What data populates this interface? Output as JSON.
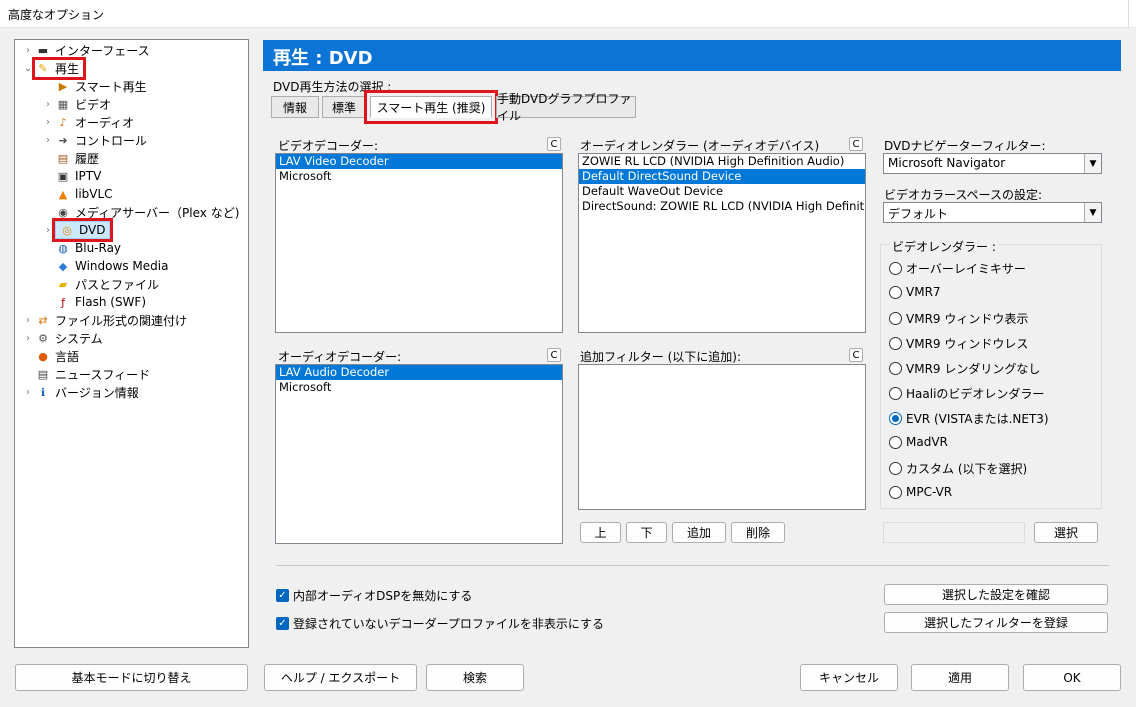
{
  "window": {
    "title": "高度なオプション"
  },
  "tree": [
    {
      "label": "インターフェース",
      "icon": "monitor-icon",
      "chev": "›",
      "indent": 0
    },
    {
      "label": "再生",
      "icon": "pencil-icon",
      "chev": "⌄",
      "indent": 0,
      "highlight": true
    },
    {
      "label": "スマート再生",
      "icon": "smart-play-icon",
      "chev": "",
      "indent": 1
    },
    {
      "label": "ビデオ",
      "icon": "film-icon",
      "chev": "›",
      "indent": 1
    },
    {
      "label": "オーディオ",
      "icon": "music-note-icon",
      "chev": "›",
      "indent": 1
    },
    {
      "label": "コントロール",
      "icon": "control-icon",
      "chev": "›",
      "indent": 1
    },
    {
      "label": "履歴",
      "icon": "history-icon",
      "chev": "",
      "indent": 1
    },
    {
      "label": "IPTV",
      "icon": "iptv-icon",
      "chev": "",
      "indent": 1
    },
    {
      "label": "libVLC",
      "icon": "vlc-cone-icon",
      "chev": "",
      "indent": 1
    },
    {
      "label": "メディアサーバー（Plex など)",
      "icon": "media-server-icon",
      "chev": "",
      "indent": 1
    },
    {
      "label": "DVD",
      "icon": "dvd-icon",
      "chev": "›",
      "indent": 1,
      "selected": true,
      "highlight": true
    },
    {
      "label": "Blu-Ray",
      "icon": "bluray-icon",
      "chev": "",
      "indent": 1
    },
    {
      "label": "Windows Media",
      "icon": "windows-media-icon",
      "chev": "",
      "indent": 1
    },
    {
      "label": "パスとファイル",
      "icon": "folder-icon",
      "chev": "",
      "indent": 1
    },
    {
      "label": "Flash (SWF)",
      "icon": "flash-icon",
      "chev": "",
      "indent": 1
    },
    {
      "label": "ファイル形式の関連付け",
      "icon": "file-assoc-icon",
      "chev": "›",
      "indent": 0
    },
    {
      "label": "システム",
      "icon": "gear-icon",
      "chev": "›",
      "indent": 0
    },
    {
      "label": "言語",
      "icon": "language-icon",
      "chev": "",
      "indent": 0
    },
    {
      "label": "ニュースフィード",
      "icon": "news-icon",
      "chev": "",
      "indent": 0
    },
    {
      "label": "バージョン情報",
      "icon": "info-icon",
      "chev": "›",
      "indent": 0
    }
  ],
  "header": {
    "title": "再生 : DVD"
  },
  "playback_method": {
    "label": "DVD再生方法の選択 :",
    "tabs": [
      "情報",
      "標準",
      "スマート再生 (推奨)",
      "手動DVDグラフプロファイル"
    ],
    "active_tab": 2
  },
  "video_decoder": {
    "label": "ビデオデコーダー:",
    "clear": "C",
    "items": [
      "LAV Video Decoder",
      "Microsoft"
    ],
    "selected": 0
  },
  "audio_renderer": {
    "label": "オーディオレンダラー (オーディオデバイス)",
    "clear": "C",
    "items": [
      "ZOWIE RL LCD (NVIDIA High Definition Audio)",
      "Default DirectSound Device",
      "Default WaveOut Device",
      "DirectSound: ZOWIE RL LCD (NVIDIA High Definition A"
    ],
    "selected": 1
  },
  "audio_decoder": {
    "label": "オーディオデコーダー:",
    "clear": "C",
    "items": [
      "LAV Audio Decoder",
      "Microsoft"
    ],
    "selected": 0
  },
  "additional_filters": {
    "label": "追加フィルター (以下に追加):",
    "clear": "C",
    "items": []
  },
  "filter_buttons": {
    "up": "上",
    "down": "下",
    "add": "追加",
    "delete": "削除"
  },
  "dvd_navigator": {
    "label": "DVDナビゲーターフィルター:",
    "value": "Microsoft Navigator"
  },
  "color_space": {
    "label": "ビデオカラースペースの設定:",
    "value": "デフォルト"
  },
  "video_renderer": {
    "label": "ビデオレンダラー :",
    "options": [
      "オーバーレイミキサー",
      "VMR7",
      "VMR9 ウィンドウ表示",
      "VMR9 ウィンドウレス",
      "VMR9 レンダリングなし",
      "Haaliのビデオレンダラー",
      "EVR (VISTAまたは.NET3)",
      "MadVR",
      "カスタム (以下を選択)",
      "MPC-VR"
    ],
    "selected": 6
  },
  "select_button": "選択",
  "checkboxes": {
    "disable_dsp": "内部オーディオDSPを無効にする",
    "hide_unregistered": "登録されていないデコーダープロファイルを非表示にする"
  },
  "confirm_button": "選択した設定を確認",
  "register_button": "選択したフィルターを登録",
  "footer": {
    "basic_mode": "基本モードに切り替え",
    "help_export": "ヘルプ / エクスポート",
    "search": "検索",
    "cancel": "キャンセル",
    "apply": "適用",
    "ok": "OK"
  },
  "colors": {
    "header_bg": "#0b74d5",
    "selection": "#0078d7",
    "highlight_box": "#e0141b"
  }
}
